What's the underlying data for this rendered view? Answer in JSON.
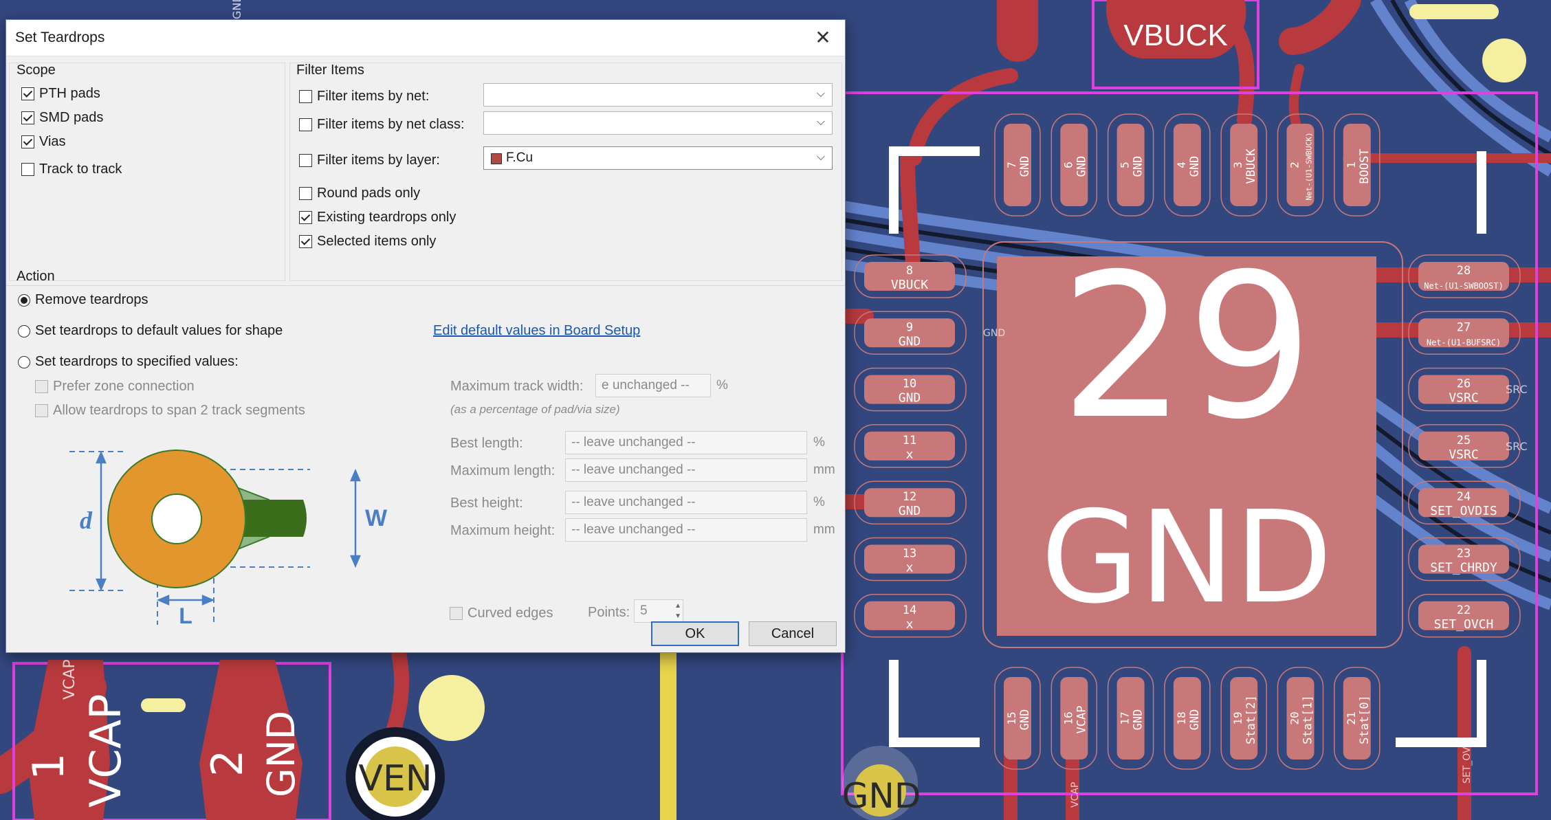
{
  "dialog": {
    "title": "Set Teardrops",
    "close_glyph": "✕",
    "scope": {
      "label": "Scope",
      "items": [
        {
          "label": "PTH pads",
          "checked": true
        },
        {
          "label": "SMD pads",
          "checked": true
        },
        {
          "label": "Vias",
          "checked": true
        },
        {
          "label": "Track to track",
          "checked": false
        }
      ]
    },
    "filter": {
      "label": "Filter Items",
      "by_net": {
        "label": "Filter items by net:",
        "checked": false,
        "value": ""
      },
      "by_net_class": {
        "label": "Filter items by net class:",
        "checked": false,
        "value": ""
      },
      "by_layer": {
        "label": "Filter items by layer:",
        "checked": false,
        "value": "F.Cu",
        "color": "#b04a44"
      },
      "round_pads_only": {
        "label": "Round pads only",
        "checked": false
      },
      "existing_teardrops_only": {
        "label": "Existing teardrops only",
        "checked": true
      },
      "selected_items_only": {
        "label": "Selected items only",
        "checked": true
      }
    },
    "action": {
      "label": "Action",
      "remove": {
        "label": "Remove teardrops",
        "selected": true
      },
      "default_values": {
        "label": "Set teardrops to default values for shape",
        "selected": false
      },
      "edit_link": "Edit default values in Board Setup",
      "specified": {
        "label": "Set teardrops to specified values:",
        "selected": false
      },
      "prefer_zone": "Prefer zone connection",
      "allow_span": "Allow teardrops to span 2 track segments"
    },
    "values": {
      "max_track_width": {
        "label": "Maximum track width:",
        "value": "e unchanged --",
        "unit": "%"
      },
      "note": "(as a percentage of pad/via size)",
      "best_length": {
        "label": "Best length:",
        "value": "-- leave unchanged --",
        "unit": "%"
      },
      "max_length": {
        "label": "Maximum length:",
        "value": "-- leave unchanged --",
        "unit": "mm"
      },
      "best_height": {
        "label": "Best height:",
        "value": "-- leave unchanged --",
        "unit": "%"
      },
      "max_height": {
        "label": "Maximum height:",
        "value": "-- leave unchanged --",
        "unit": "mm"
      },
      "curved_edges": "Curved edges",
      "points_label": "Points:",
      "points_value": "5"
    },
    "diagram": {
      "d": "d",
      "w": "W",
      "l": "L"
    },
    "buttons": {
      "ok": "OK",
      "cancel": "Cancel"
    }
  },
  "pcb": {
    "silk_top": "VBUCK",
    "center_number": "29",
    "center_net": "GND",
    "top_pads": [
      {
        "num": "7",
        "net": "GND"
      },
      {
        "num": "6",
        "net": "GND"
      },
      {
        "num": "5",
        "net": "GND"
      },
      {
        "num": "4",
        "net": "GND"
      },
      {
        "num": "3",
        "net": "VBUCK"
      },
      {
        "num": "2",
        "net": "Net-(U1-SWBUCK)"
      },
      {
        "num": "1",
        "net": "BOOST"
      }
    ],
    "left_pads": [
      {
        "num": "8",
        "net": "VBUCK"
      },
      {
        "num": "9",
        "net": "GND"
      },
      {
        "num": "10",
        "net": "GND"
      },
      {
        "num": "11",
        "net": "x"
      },
      {
        "num": "12",
        "net": "GND"
      },
      {
        "num": "13",
        "net": "x"
      },
      {
        "num": "14",
        "net": "x"
      }
    ],
    "right_pads": [
      {
        "num": "28",
        "net": "Net-(U1-SWBOOST)"
      },
      {
        "num": "27",
        "net": "Net-(U1-BUFSRC)"
      },
      {
        "num": "26",
        "net": "VSRC"
      },
      {
        "num": "25",
        "net": "VSRC"
      },
      {
        "num": "24",
        "net": "SET_OVDIS"
      },
      {
        "num": "23",
        "net": "SET_CHRDY"
      },
      {
        "num": "22",
        "net": "SET_OVCH"
      }
    ],
    "bottom_pads": [
      {
        "num": "15",
        "net": "GND"
      },
      {
        "num": "16",
        "net": "VCAP"
      },
      {
        "num": "17",
        "net": "GND"
      },
      {
        "num": "18",
        "net": "GND"
      },
      {
        "num": "19",
        "net": "Stat[2]"
      },
      {
        "num": "20",
        "net": "Stat[1]"
      },
      {
        "num": "21",
        "net": "Stat[0]"
      }
    ],
    "left_big": [
      {
        "num": "1",
        "net": "VCAP"
      },
      {
        "num": "2",
        "net": "GND"
      }
    ],
    "small_labels": {
      "vcap": "VCAP",
      "gnd_rot": "GND",
      "ven": "VEN",
      "gnd_via": "GND",
      "gnd_small": "GND",
      "src1": "SRC",
      "src2": "SRC",
      "set_ov": "SET_OV",
      "vcap_small": "VCAP"
    },
    "colors": {
      "board": "#33477f",
      "copper": "#b93a3e",
      "pad": "#c9787a",
      "pad_text": "#ffffff",
      "silk": "#ffffff",
      "courtyard": "#e040e0",
      "via": "#f5f0a0",
      "inner": "#6a8ad6"
    }
  }
}
